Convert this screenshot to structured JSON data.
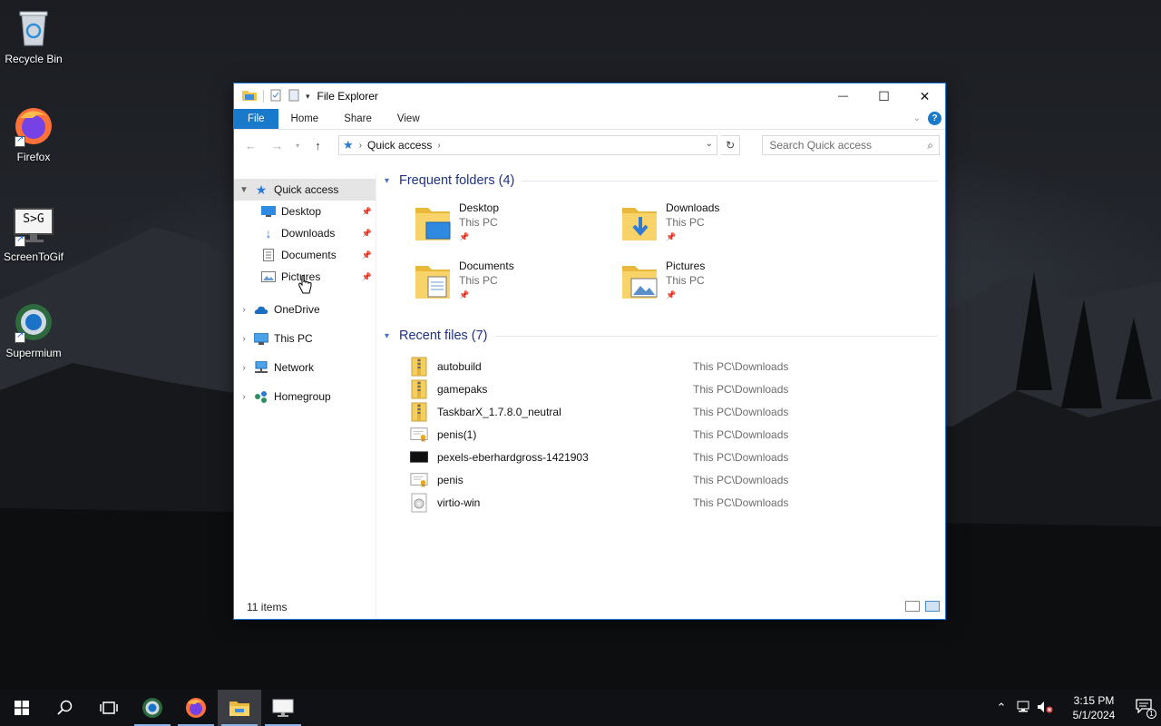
{
  "desktop": {
    "icons": [
      {
        "label": "Recycle Bin",
        "icon": "recycle-bin-icon"
      },
      {
        "label": "Firefox",
        "icon": "firefox-icon"
      },
      {
        "label": "ScreenToGif",
        "icon": "screentogif-icon",
        "glyph_text": "S>G"
      },
      {
        "label": "Supermium",
        "icon": "supermium-icon"
      }
    ]
  },
  "window": {
    "title": "File Explorer",
    "caption": {
      "minimize": "—",
      "maximize": "☐",
      "close": "✕"
    },
    "ribbon_tabs": [
      "File",
      "Home",
      "Share",
      "View"
    ],
    "help_label": "?",
    "address": {
      "location": "Quick access"
    },
    "search": {
      "placeholder": "Search Quick access"
    },
    "nav_pane": {
      "quick_access": "Quick access",
      "pinned": [
        "Desktop",
        "Downloads",
        "Documents",
        "Pictures"
      ],
      "roots": [
        "OneDrive",
        "This PC",
        "Network",
        "Homegroup"
      ]
    },
    "frequent": {
      "header": "Frequent folders (4)",
      "folders": [
        {
          "name": "Desktop",
          "location": "This PC"
        },
        {
          "name": "Downloads",
          "location": "This PC"
        },
        {
          "name": "Documents",
          "location": "This PC"
        },
        {
          "name": "Pictures",
          "location": "This PC"
        }
      ]
    },
    "recent": {
      "header": "Recent files (7)",
      "files": [
        {
          "name": "autobuild",
          "path": "This PC\\Downloads",
          "kind": "zip"
        },
        {
          "name": "gamepaks",
          "path": "This PC\\Downloads",
          "kind": "zip"
        },
        {
          "name": "TaskbarX_1.7.8.0_neutral",
          "path": "This PC\\Downloads",
          "kind": "zip"
        },
        {
          "name": "penis(1)",
          "path": "This PC\\Downloads",
          "kind": "cert"
        },
        {
          "name": "pexels-eberhardgross-1421903",
          "path": "This PC\\Downloads",
          "kind": "image"
        },
        {
          "name": "penis",
          "path": "This PC\\Downloads",
          "kind": "cert"
        },
        {
          "name": "virtio-win",
          "path": "This PC\\Downloads",
          "kind": "disc"
        }
      ]
    },
    "status": "11 items"
  },
  "taskbar": {
    "time": "3:15 PM",
    "date": "5/1/2024",
    "notification_count": "1"
  },
  "colors": {
    "accent": "#1979ca",
    "group_header": "#1e3287",
    "taskbar": "#101114"
  }
}
